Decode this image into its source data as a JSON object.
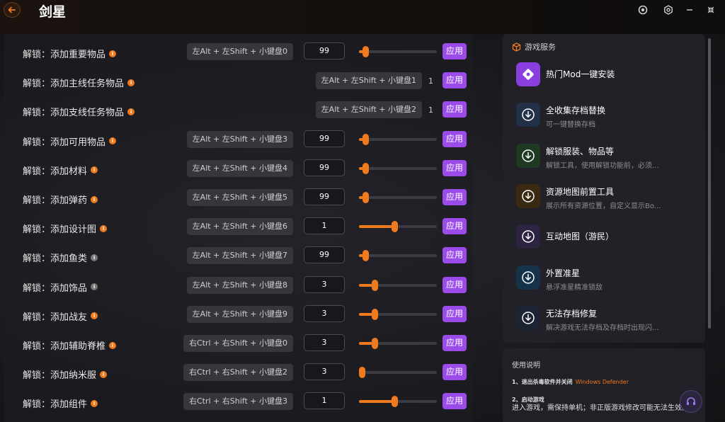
{
  "window": {
    "title": "剑星",
    "icons": [
      "back-arrow-icon",
      "account-icon",
      "settings-icon",
      "minimize-icon",
      "shrink-icon"
    ]
  },
  "accent": "#f07a1e",
  "apply_color": "#9b4bea",
  "rows": [
    {
      "label": "解锁：添加重要物品",
      "info": "orange",
      "hotkey": "左Alt + 左Shift + 小键盘0",
      "value": "99",
      "slider": 0.08,
      "apply": "应用"
    },
    {
      "label": "解锁：添加主线任务物品",
      "info": "orange",
      "hotkey": "左Alt + 左Shift + 小键盘1",
      "value": "1",
      "slider": null,
      "apply": "应用"
    },
    {
      "label": "解锁：添加支线任务物品",
      "info": "orange",
      "hotkey": "左Alt + 左Shift + 小键盘2",
      "value": "1",
      "slider": null,
      "apply": "应用"
    },
    {
      "label": "解锁：添加可用物品",
      "info": "orange",
      "hotkey": "左Alt + 左Shift + 小键盘3",
      "value": "99",
      "slider": 0.08,
      "apply": "应用"
    },
    {
      "label": "解锁：添加材料",
      "info": "orange",
      "hotkey": "左Alt + 左Shift + 小键盘4",
      "value": "99",
      "slider": 0.08,
      "apply": "应用"
    },
    {
      "label": "解锁：添加弹药",
      "info": "orange",
      "hotkey": "左Alt + 左Shift + 小键盘5",
      "value": "99",
      "slider": 0.08,
      "apply": "应用"
    },
    {
      "label": "解锁：添加设计图",
      "info": "orange",
      "hotkey": "左Alt + 左Shift + 小键盘6",
      "value": "1",
      "slider": 0.45,
      "apply": "应用"
    },
    {
      "label": "解锁：添加鱼类",
      "info": "gray",
      "hotkey": "左Alt + 左Shift + 小键盘7",
      "value": "99",
      "slider": 0.08,
      "apply": "应用"
    },
    {
      "label": "解锁：添加饰品",
      "info": "gray",
      "hotkey": "左Alt + 左Shift + 小键盘8",
      "value": "3",
      "slider": 0.2,
      "apply": "应用"
    },
    {
      "label": "解锁：添加战友",
      "info": "orange",
      "hotkey": "左Alt + 左Shift + 小键盘9",
      "value": "3",
      "slider": 0.2,
      "apply": "应用"
    },
    {
      "label": "解锁：添加辅助脊椎",
      "info": "orange",
      "hotkey": "右Ctrl + 右Shift + 小键盘0",
      "value": "3",
      "slider": 0.2,
      "apply": "应用"
    },
    {
      "label": "解锁：添加纳米服",
      "info": "orange",
      "hotkey": "右Ctrl + 右Shift + 小键盘2",
      "value": "3",
      "slider": 0.0,
      "apply": "应用"
    },
    {
      "label": "解锁：添加组件",
      "info": "orange",
      "hotkey": "右Ctrl + 右Shift + 小键盘3",
      "value": "1",
      "slider": 0.45,
      "apply": "应用"
    }
  ],
  "services": {
    "header": "游戏服务",
    "items": [
      {
        "title": "热门Mod一键安装",
        "subtitle": "",
        "icon": "mod-icon"
      },
      {
        "title": "全收集存档替换",
        "subtitle": "可一键替换存档",
        "icon": "download-icon"
      },
      {
        "title": "解锁服装、物品等",
        "subtitle": "解锁工具，使用解锁功能前，必须...",
        "icon": "download-icon"
      },
      {
        "title": "资源地图前置工具",
        "subtitle": "展示所有资源位置，自定义显示Bo...",
        "icon": "download-icon"
      },
      {
        "title": "互动地图（游民）",
        "subtitle": "",
        "icon": "download-icon"
      },
      {
        "title": "外置准星",
        "subtitle": "悬浮准星精准锁敌",
        "icon": "download-icon"
      },
      {
        "title": "无法存档修复",
        "subtitle": "解决游戏无法存档及存档时出现闪...",
        "icon": "download-icon"
      }
    ]
  },
  "manual": {
    "title": "使用说明",
    "step1": "1、退出杀毒软件并关闭",
    "step1_highlight": "Windows Defender",
    "step2": "2、启动游戏",
    "step2_desc": "进入游戏，需保持单机；非正版游戏修改可能无法生效。"
  }
}
